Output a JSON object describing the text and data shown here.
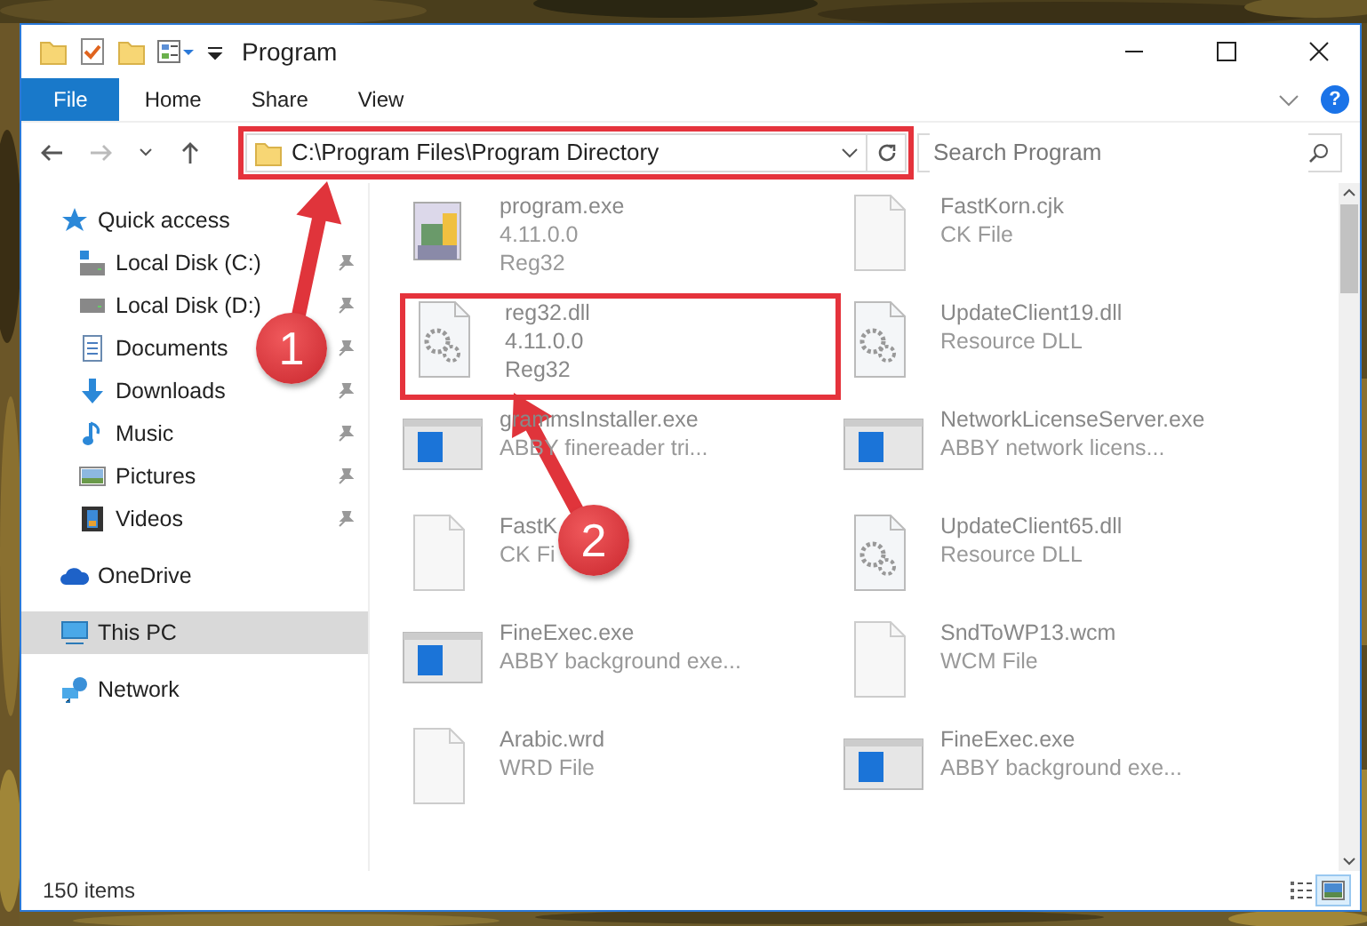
{
  "window": {
    "title": "Program"
  },
  "ribbon": {
    "tabs": [
      {
        "label": "File",
        "selected": true
      },
      {
        "label": "Home",
        "selected": false
      },
      {
        "label": "Share",
        "selected": false
      },
      {
        "label": "View",
        "selected": false
      }
    ],
    "help": "?"
  },
  "address": {
    "path": "C:\\Program Files\\Program Directory",
    "search_placeholder": "Search Program"
  },
  "sidebar": {
    "items": [
      {
        "label": "Quick access",
        "kind": "star",
        "selected": false,
        "children": [
          {
            "label": "Local Disk (C:)",
            "kind": "system-disk",
            "pinned": true
          },
          {
            "label": "Local Disk (D:)",
            "kind": "disk",
            "pinned": true
          },
          {
            "label": "Documents",
            "kind": "documents",
            "pinned": true
          },
          {
            "label": "Downloads",
            "kind": "downloads",
            "pinned": true
          },
          {
            "label": "Music",
            "kind": "music",
            "pinned": true
          },
          {
            "label": "Pictures",
            "kind": "pictures",
            "pinned": true
          },
          {
            "label": "Videos",
            "kind": "videos",
            "pinned": true
          }
        ]
      },
      {
        "label": "OneDrive",
        "kind": "cloud",
        "selected": false
      },
      {
        "label": "This PC",
        "kind": "computer",
        "selected": true
      },
      {
        "label": "Network",
        "kind": "network",
        "selected": false
      }
    ]
  },
  "files": [
    {
      "kind": "setup",
      "lines": [
        "program.exe",
        "4.11.0.0",
        "Reg32"
      ],
      "focused": false
    },
    {
      "kind": "blank",
      "lines": [
        "FastKorn.cjk",
        "CK File"
      ],
      "focused": false
    },
    {
      "kind": "dll",
      "lines": [
        "reg32.dll",
        "4.11.0.0",
        "Reg32"
      ],
      "focused": true
    },
    {
      "kind": "dll",
      "lines": [
        "UpdateClient19.dll",
        "Resource DLL"
      ],
      "focused": false
    },
    {
      "kind": "window",
      "lines": [
        "grammsInstaller.exe",
        "ABBY finereader tri..."
      ],
      "focused": false
    },
    {
      "kind": "window",
      "lines": [
        "NetworkLicenseServer.exe",
        "ABBY network licens..."
      ],
      "focused": false
    },
    {
      "kind": "blank",
      "lines": [
        "FastK",
        "CK Fi"
      ],
      "focused": false
    },
    {
      "kind": "dll",
      "lines": [
        "UpdateClient65.dll",
        "Resource DLL"
      ],
      "focused": false
    },
    {
      "kind": "window",
      "lines": [
        "FineExec.exe",
        "ABBY background exe..."
      ],
      "focused": false
    },
    {
      "kind": "blank",
      "lines": [
        "SndToWP13.wcm",
        "WCM File"
      ],
      "focused": false
    },
    {
      "kind": "blank",
      "lines": [
        "Arabic.wrd",
        "WRD File"
      ],
      "focused": false
    },
    {
      "kind": "window",
      "lines": [
        "FineExec.exe",
        "ABBY background exe..."
      ],
      "focused": false
    }
  ],
  "status_bar": {
    "count": "150 items",
    "views": [
      {
        "kind": "details",
        "selected": false
      },
      {
        "kind": "large",
        "selected": true
      }
    ]
  },
  "annotations": [
    {
      "number": "1"
    },
    {
      "number": "2"
    }
  ]
}
